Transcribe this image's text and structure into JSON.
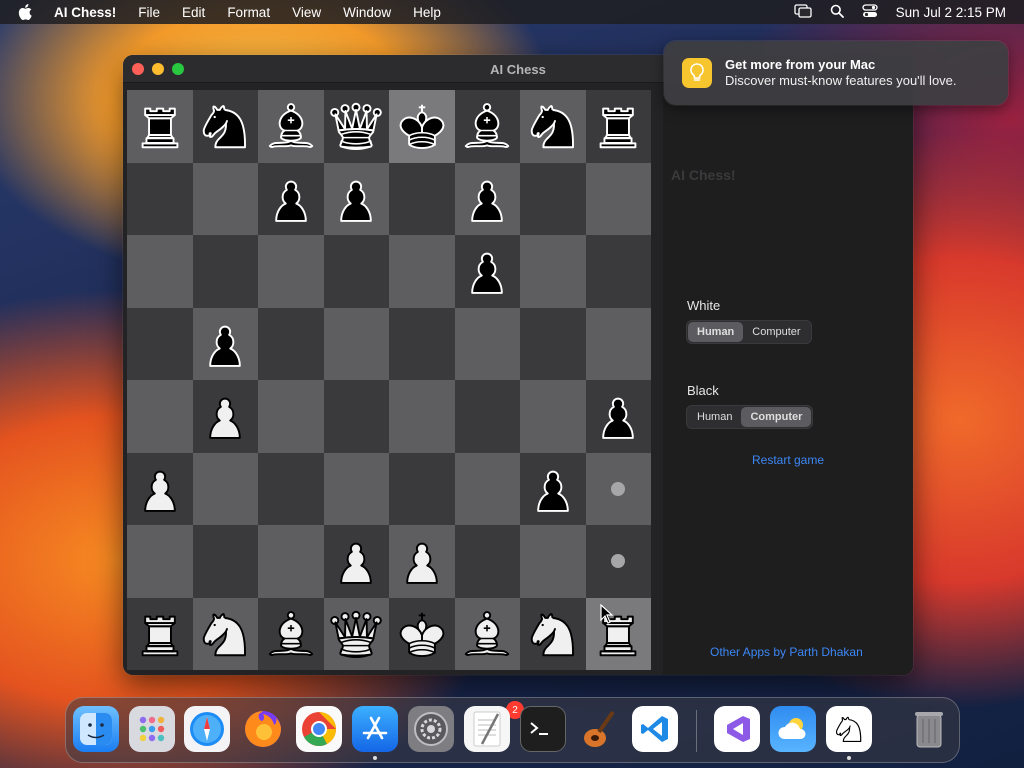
{
  "menubar": {
    "app_name": "AI Chess!",
    "items": [
      "File",
      "Edit",
      "Format",
      "View",
      "Window",
      "Help"
    ],
    "clock": "Sun Jul 2  2:15 PM",
    "icons": [
      "screen-mirroring-icon",
      "search-icon",
      "control-center-icon"
    ]
  },
  "window": {
    "title": "AI Chess",
    "board": {
      "ranks": [
        [
          "bR",
          "bN",
          "bB",
          "bQ",
          "bK",
          "bB",
          "bN",
          "bR"
        ],
        [
          "",
          "",
          "bP",
          "bP",
          "",
          "bP",
          "",
          ""
        ],
        [
          "",
          "",
          "",
          "",
          "",
          "bP",
          "",
          ""
        ],
        [
          "",
          "bP",
          "",
          "",
          "",
          "",
          "",
          ""
        ],
        [
          "",
          "wP",
          "",
          "",
          "",
          "",
          "",
          "bP"
        ],
        [
          "wP",
          "",
          "",
          "",
          "",
          "",
          "bP",
          "."
        ],
        [
          "",
          "",
          "",
          "wP",
          "wP",
          "",
          "",
          "."
        ],
        [
          "wR",
          "wN",
          "wB",
          "wQ",
          "wK",
          "wB",
          "wN",
          "wR"
        ]
      ],
      "highlighted": [
        "e8",
        "h1"
      ]
    },
    "side": {
      "title": "AI Chess!",
      "subtitle": "",
      "white_label": "White",
      "white_options": [
        "Human",
        "Computer"
      ],
      "white_selected": "Human",
      "black_label": "Black",
      "black_options": [
        "Human",
        "Computer"
      ],
      "black_selected": "Computer",
      "restart_label": "Restart game",
      "other_apps_label": "Other Apps by Parth Dhakan"
    }
  },
  "notification": {
    "title": "Get more from your Mac",
    "body": "Discover must-know features you'll love.",
    "icon": "lightbulb-icon",
    "icon_color": "#f7c52e"
  },
  "dock": {
    "items": [
      "finder-icon",
      "launchpad-icon",
      "safari-icon",
      "firefox-icon",
      "chrome-icon",
      "app-store-icon",
      "system-settings-icon",
      "textedit-icon",
      "terminal-icon",
      "garageband-icon",
      "vscode-icon",
      "visual-studio-icon",
      "weather-icon",
      "chess-icon",
      "trash-icon"
    ],
    "settings_badge": "2"
  }
}
